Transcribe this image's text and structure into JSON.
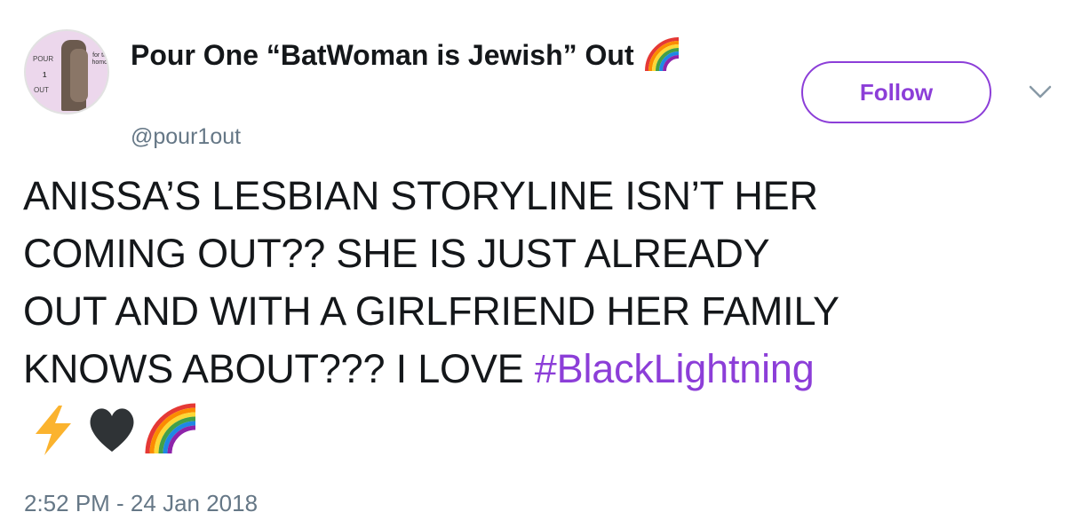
{
  "author": {
    "display_name": "Pour One “BatWoman is Jewish” Out",
    "handle": "@pour1out",
    "avatar_text": {
      "top": "POUR",
      "middle": "1",
      "bottom": "OUT",
      "side": "for the homos"
    }
  },
  "follow_button": {
    "label": "Follow"
  },
  "tweet": {
    "lines": [
      "ANISSA’S LESBIAN STORYLINE ISN’T HER",
      "COMING OUT?? SHE IS JUST ALREADY",
      "OUT AND WITH A GIRLFRIEND HER FAMILY",
      "KNOWS ABOUT??? I LOVE "
    ],
    "hashtag": "#BlackLightning",
    "emojis": [
      "high-voltage-emoji",
      "black-heart-emoji",
      "rainbow-emoji"
    ]
  },
  "timestamp": "2:52 PM - 24 Jan 2018",
  "colors": {
    "accent": "#8c3ed8",
    "text": "#14171a",
    "muted": "#657786"
  }
}
